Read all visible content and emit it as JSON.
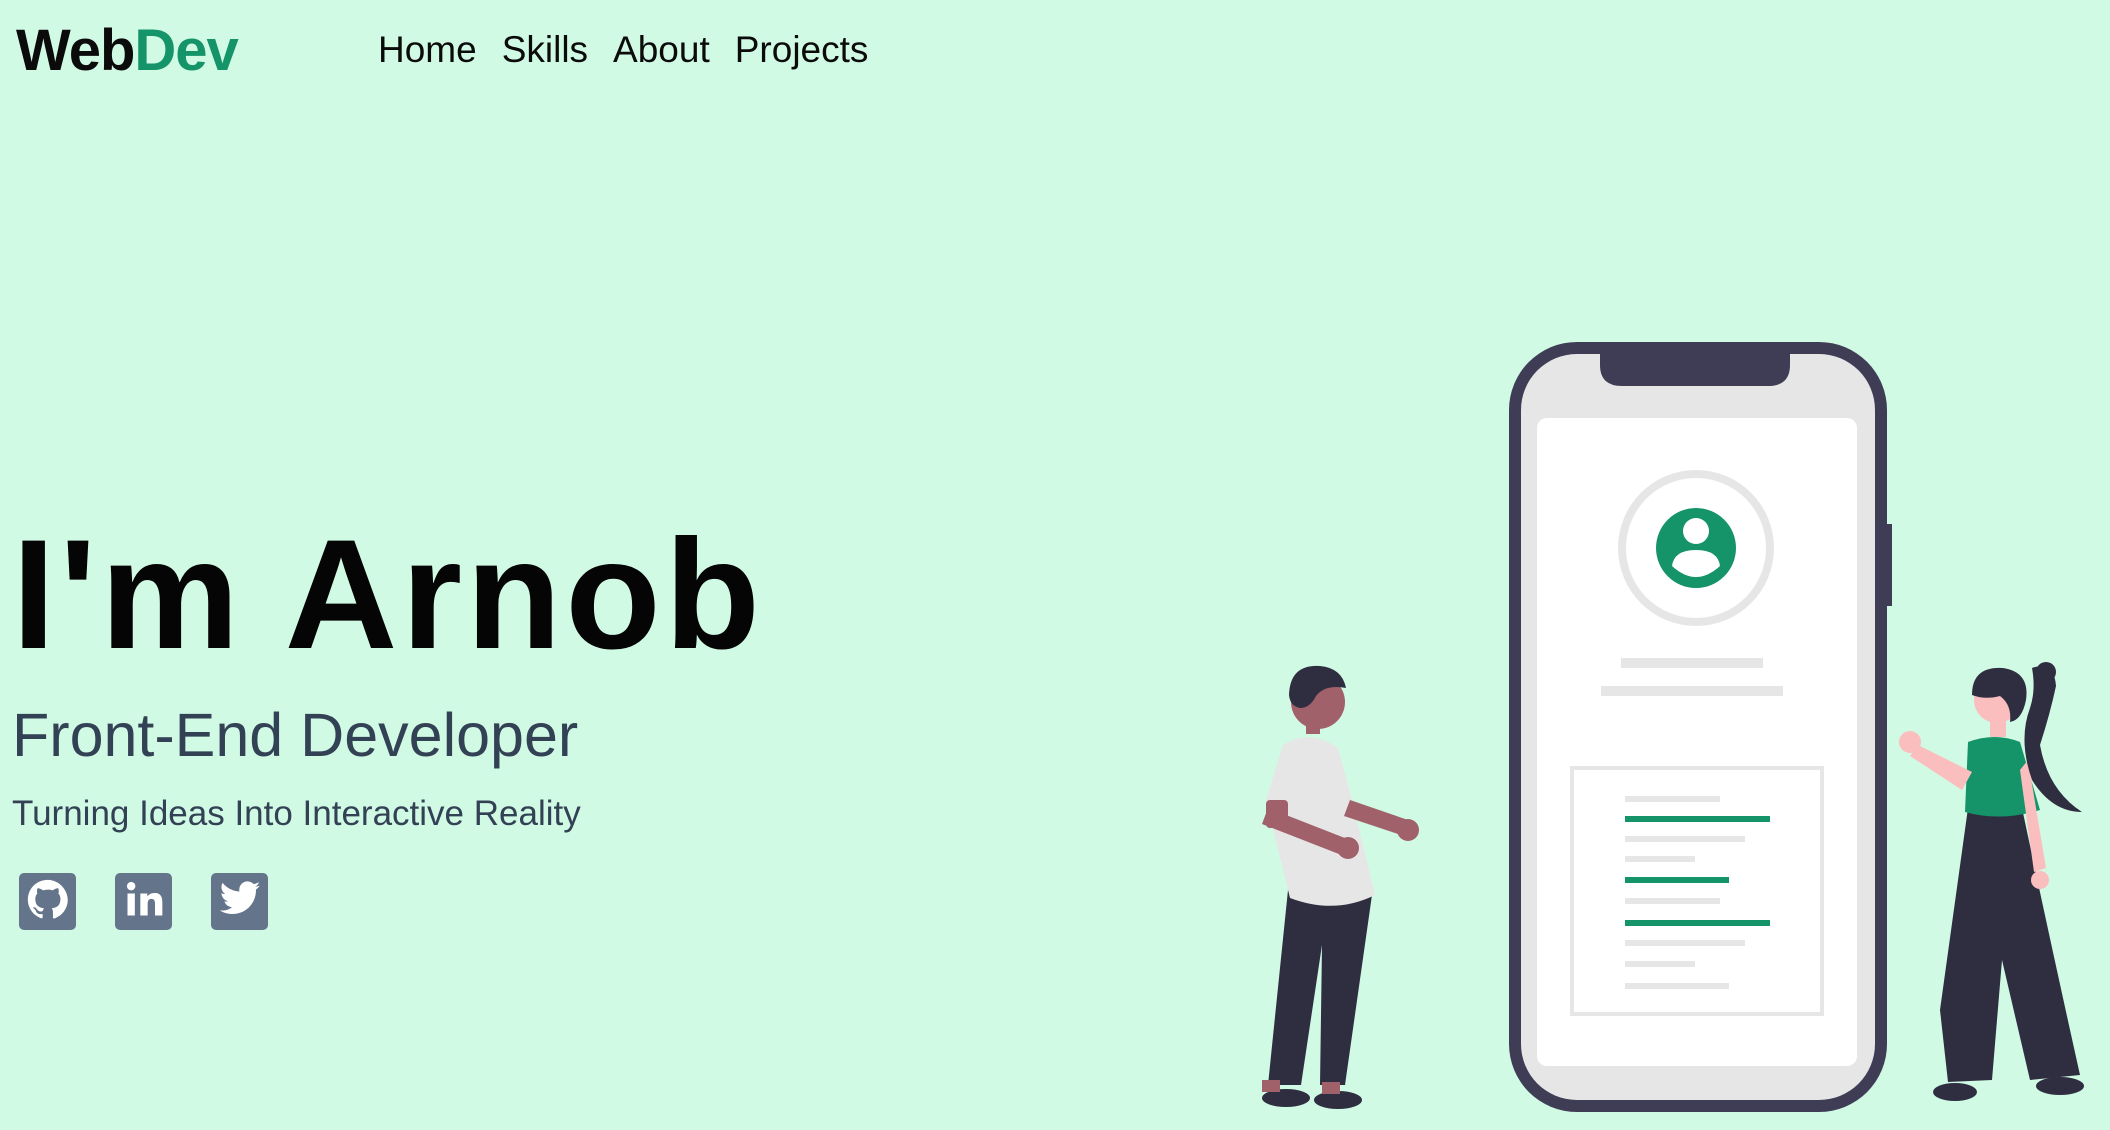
{
  "brand": {
    "part1": "Web",
    "part2": "Dev"
  },
  "nav": {
    "items": [
      "Home",
      "Skills",
      "About",
      "Projects"
    ]
  },
  "hero": {
    "title": "I'm Arnob",
    "role": "Front-End Developer",
    "tagline": "Turning Ideas Into Interactive Reality"
  },
  "social": {
    "icons": [
      "github-icon",
      "linkedin-icon",
      "twitter-icon"
    ]
  },
  "colors": {
    "background": "#d1fae5",
    "accent": "#149468",
    "text": "#0b0b0b",
    "muted": "#334155",
    "icon": "#64748b"
  }
}
